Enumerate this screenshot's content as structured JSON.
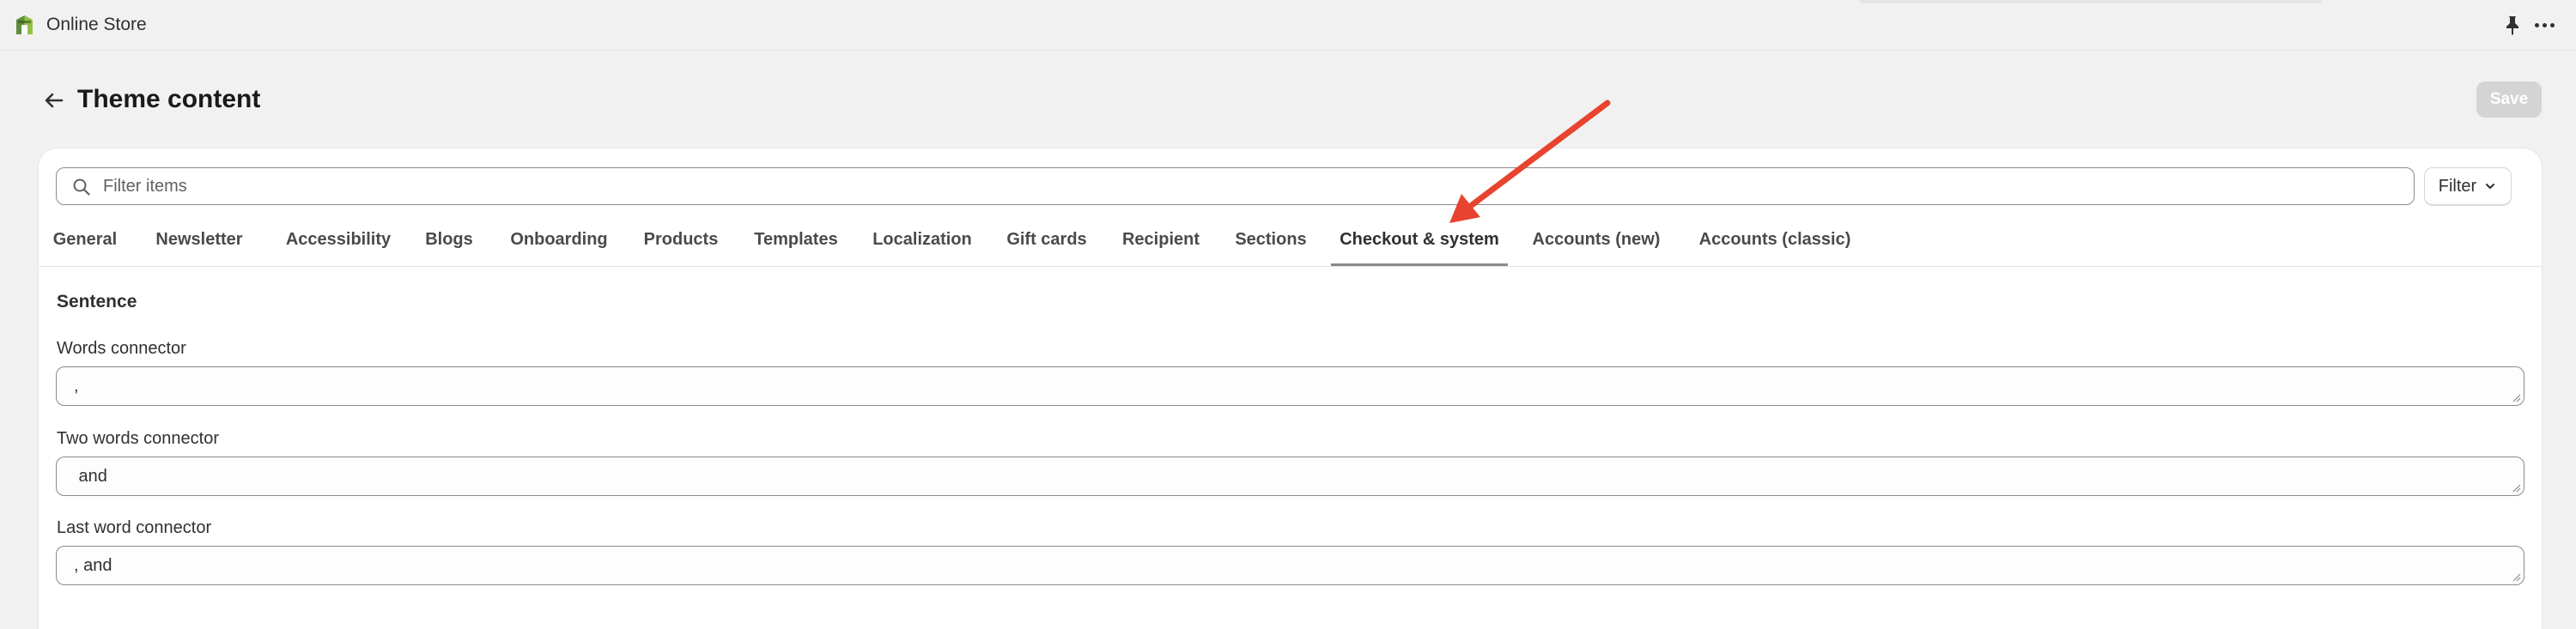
{
  "app": {
    "name": "Online Store",
    "icon": "shopify-store-icon",
    "brand_color": "#95bf47"
  },
  "topbar": {
    "pin_icon": "pin-icon",
    "more_icon": "more-horizontal-icon"
  },
  "header": {
    "back_icon": "arrow-left-icon",
    "title": "Theme content",
    "save_label": "Save"
  },
  "search": {
    "placeholder": "Filter items",
    "value": "",
    "icon": "search-icon"
  },
  "filter": {
    "label": "Filter",
    "icon": "chevron-down-icon"
  },
  "tabs": [
    {
      "label": "General",
      "active": false
    },
    {
      "label": "Newsletter",
      "active": false
    },
    {
      "label": "Accessibility",
      "active": false
    },
    {
      "label": "Blogs",
      "active": false
    },
    {
      "label": "Onboarding",
      "active": false
    },
    {
      "label": "Products",
      "active": false
    },
    {
      "label": "Templates",
      "active": false
    },
    {
      "label": "Localization",
      "active": false
    },
    {
      "label": "Gift cards",
      "active": false
    },
    {
      "label": "Recipient",
      "active": false
    },
    {
      "label": "Sections",
      "active": false
    },
    {
      "label": "Checkout & system",
      "active": true
    },
    {
      "label": "Accounts (new)",
      "active": false
    },
    {
      "label": "Accounts (classic)",
      "active": false
    }
  ],
  "annotation": {
    "color": "#e8432e",
    "points_to": "Checkout & system"
  },
  "section": {
    "heading": "Sentence",
    "fields": [
      {
        "label": "Words connector",
        "value": ","
      },
      {
        "label": "Two words connector",
        "value": " and"
      },
      {
        "label": "Last word connector",
        "value": ", and"
      }
    ]
  }
}
